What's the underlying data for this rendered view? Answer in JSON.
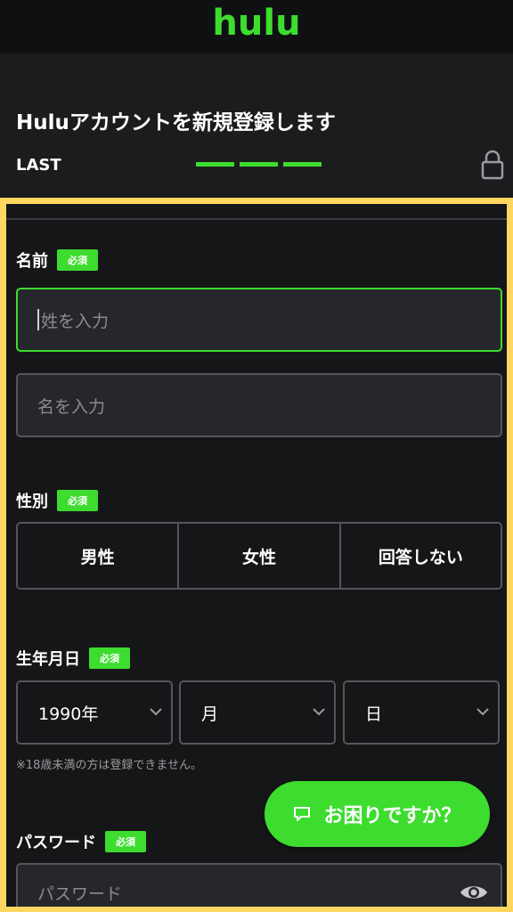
{
  "header": {
    "logo": "hulu",
    "title": "Huluアカウントを新規登録します",
    "step": "LAST",
    "progress_steps": 3
  },
  "form": {
    "name": {
      "label": "名前",
      "required": "必須",
      "last_placeholder": "姓を入力",
      "first_placeholder": "名を入力"
    },
    "gender": {
      "label": "性別",
      "required": "必須",
      "options": [
        "男性",
        "女性",
        "回答しない"
      ]
    },
    "birthdate": {
      "label": "生年月日",
      "required": "必須",
      "year": "1990年",
      "month": "月",
      "day": "日",
      "note": "※18歳未満の方は登録できません。"
    },
    "password": {
      "label": "パスワード",
      "required": "必須",
      "placeholder": "パスワード"
    }
  },
  "help": {
    "label": "お困りですか？"
  },
  "colors": {
    "accent": "#3ddc2f",
    "highlight_frame": "#ffd660",
    "background": "#1b1c1e"
  }
}
